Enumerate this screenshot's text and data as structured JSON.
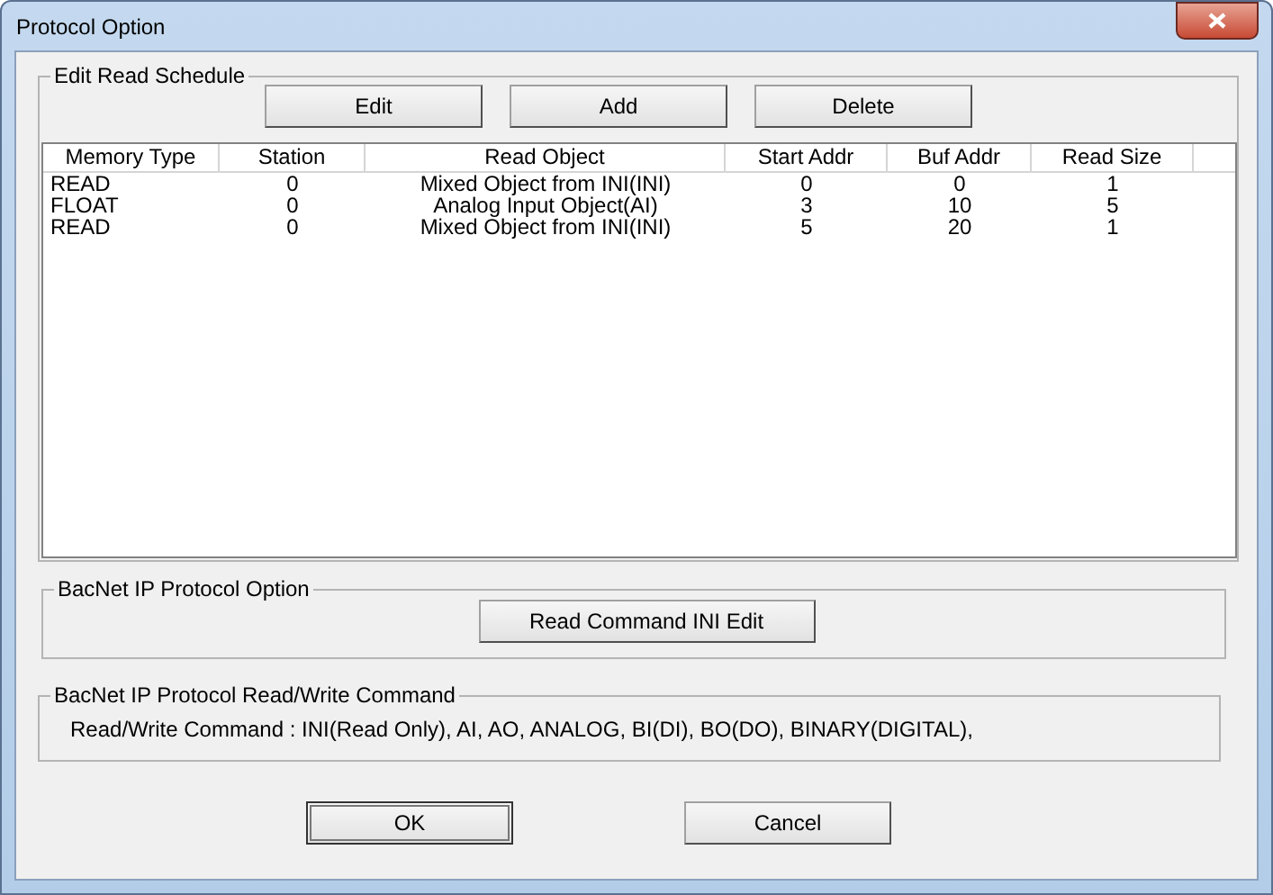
{
  "window": {
    "title": "Protocol Option"
  },
  "schedule": {
    "title": "Edit Read Schedule",
    "buttons": [
      "Edit",
      "Add",
      "Delete"
    ],
    "columns": [
      "Memory Type",
      "Station",
      "Read Object",
      "Start Addr",
      "Buf Addr",
      "Read Size"
    ],
    "rows": [
      [
        "READ",
        "0",
        "Mixed Object from INI(INI)",
        "0",
        "0",
        "1"
      ],
      [
        "FLOAT",
        "0",
        "Analog Input Object(AI)",
        "3",
        "10",
        "5"
      ],
      [
        "READ",
        "0",
        "Mixed Object from INI(INI)",
        "5",
        "20",
        "1"
      ]
    ]
  },
  "protocol_option": {
    "title": "BacNet IP Protocol Option",
    "button": "Read Command INI Edit"
  },
  "read_write": {
    "title": "BacNet IP Protocol Read/Write Command",
    "text": "Read/Write Command : INI(Read Only), AI, AO, ANALOG, BI(DI), BO(DO), BINARY(DIGITAL),"
  },
  "buttons": [
    {
      "label": "OK",
      "default": true
    },
    {
      "label": "Cancel",
      "default": false
    }
  ]
}
